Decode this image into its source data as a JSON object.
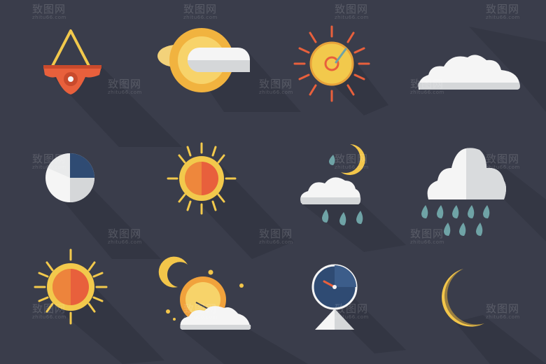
{
  "watermark": {
    "text": "致图网",
    "subtext": "zhitu66.com"
  },
  "colors": {
    "background": "#3a3d4b",
    "shadow": "#303340",
    "sun_yellow": "#f2c94c",
    "sun_orange": "#f1b33f",
    "sun_core": "#e8603c",
    "cloud_white": "#f5f5f5",
    "cloud_shade": "#d5d7d9",
    "rain_teal": "#6fa3a6",
    "moon_yellow": "#f3c64a",
    "red": "#e55a3c",
    "navy": "#2f4b73"
  },
  "icons": [
    {
      "name": "weather-vane-icon"
    },
    {
      "name": "sun-behind-cloud-icon"
    },
    {
      "name": "sun-rays-icon"
    },
    {
      "name": "cloud-icon"
    },
    {
      "name": "pie-chart-icon"
    },
    {
      "name": "sun-icon"
    },
    {
      "name": "moon-cloud-rain-icon"
    },
    {
      "name": "rain-cloud-icon"
    },
    {
      "name": "sun-large-icon"
    },
    {
      "name": "night-sun-cloud-icon"
    },
    {
      "name": "barometer-icon"
    },
    {
      "name": "crescent-moon-icon"
    }
  ]
}
